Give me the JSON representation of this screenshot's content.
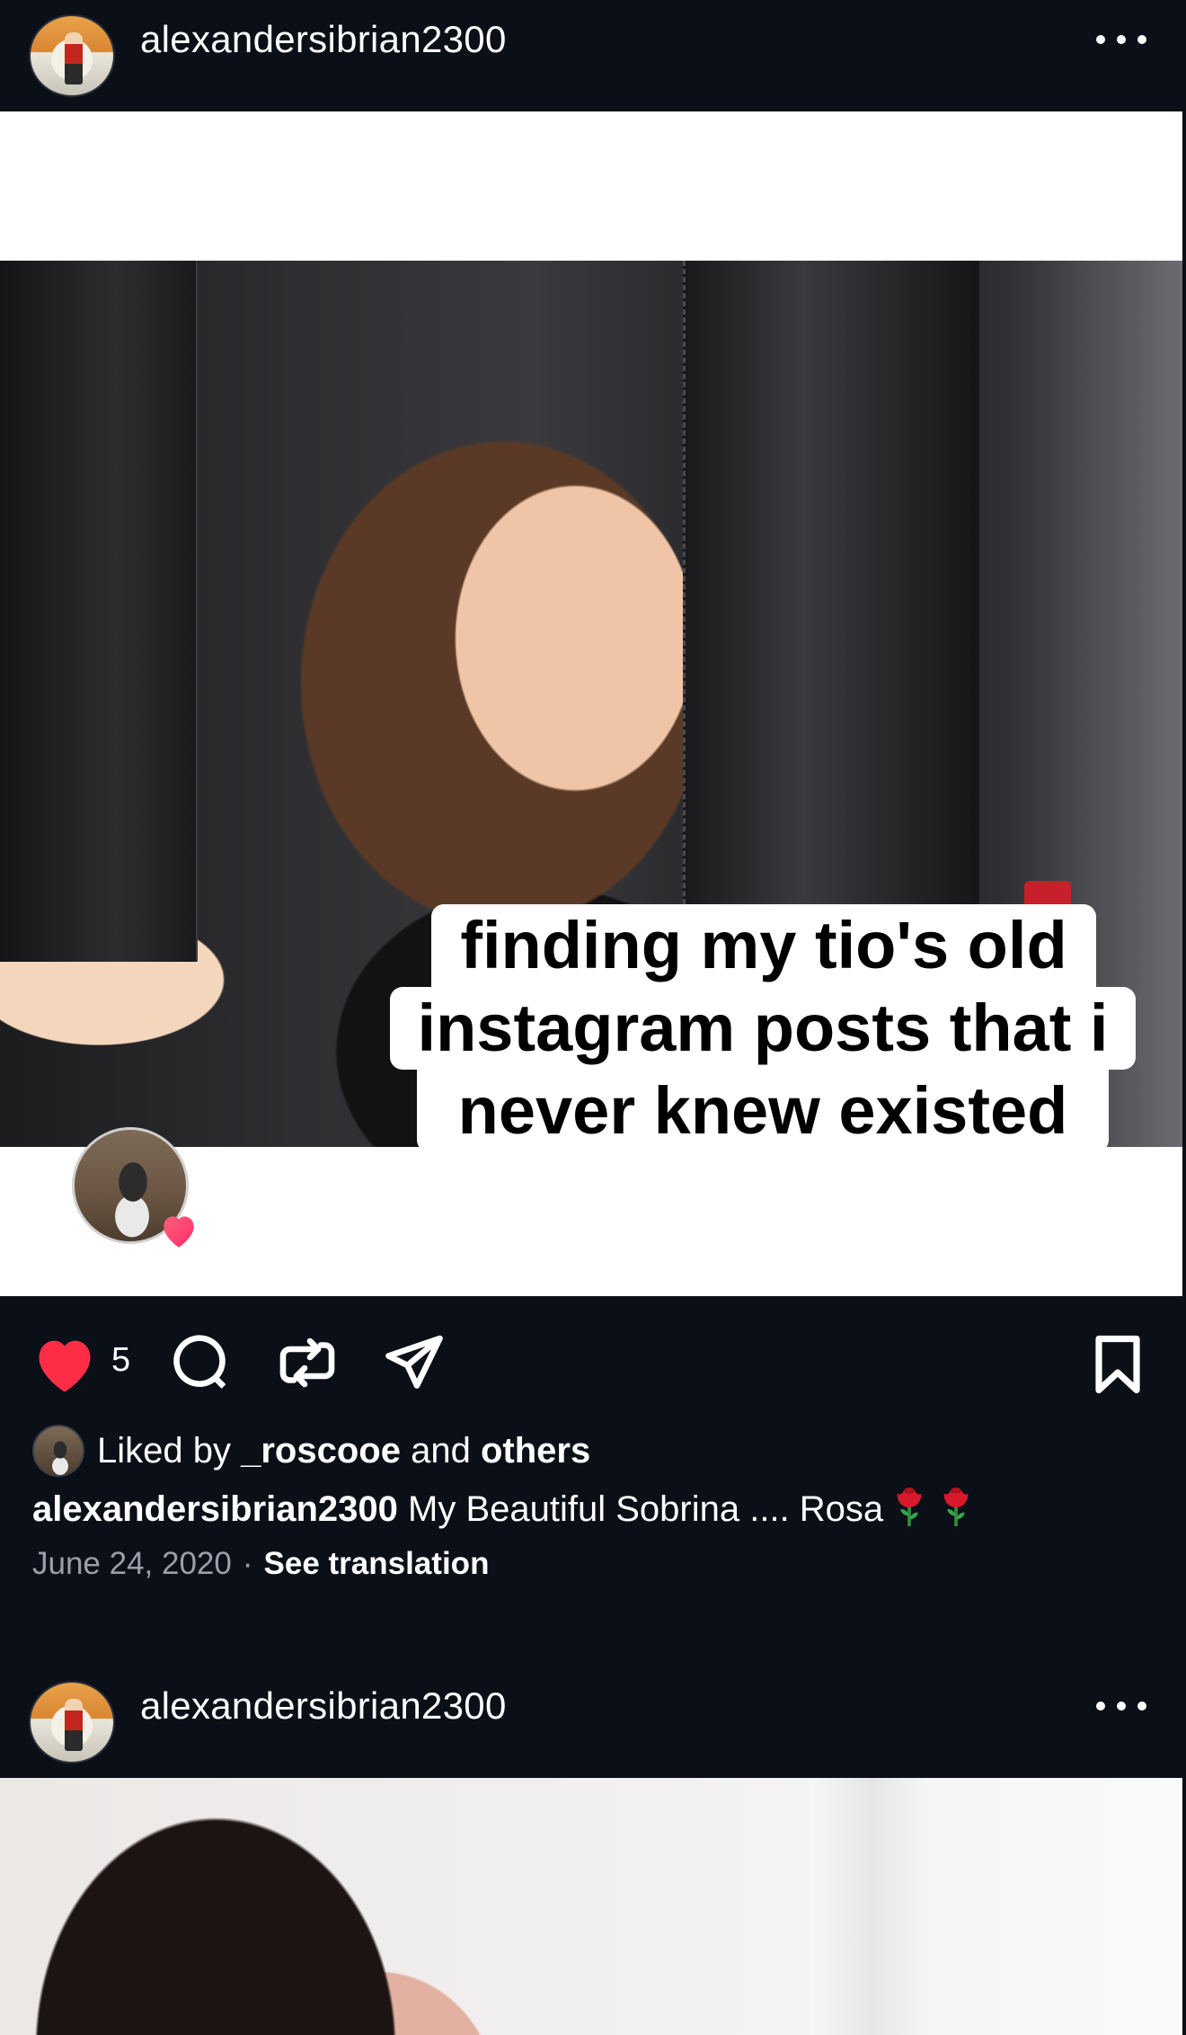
{
  "post1": {
    "username": "alexandersibrian2300",
    "caption_overlay": [
      "finding my tio's old",
      "instagram posts that i",
      "never knew existed"
    ],
    "likes_count": "5",
    "liked_by_prefix": "Liked by ",
    "liked_by_user": "_roscooe",
    "liked_by_mid": " and ",
    "liked_by_others": "others",
    "caption_user": "alexandersibrian2300",
    "caption_text": " My Beautiful Sobrina .... Rosa",
    "date": "June 24, 2020",
    "dot": "·",
    "see_translation": "See translation"
  },
  "post2": {
    "username": "alexandersibrian2300"
  },
  "icons": {
    "more": "more-horizontal-icon",
    "like": "heart-filled-icon",
    "comment": "comment-bubble-icon",
    "repost": "repost-icon",
    "share": "send-icon",
    "bookmark": "bookmark-icon",
    "rose": "rose-emoji-icon"
  },
  "colors": {
    "background": "#0b0f17",
    "like_red": "#ff2d46",
    "muted_text": "#9aa0ab"
  }
}
